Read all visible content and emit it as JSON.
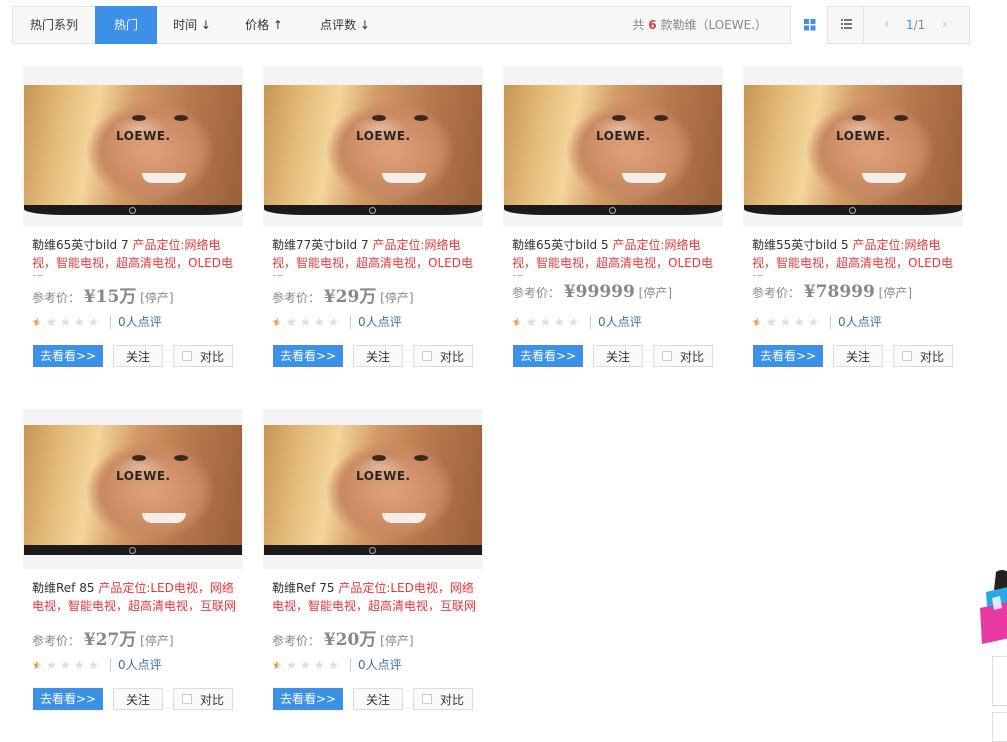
{
  "sort_bar": {
    "tabs": [
      {
        "label": "热门系列",
        "active": false
      },
      {
        "label": "热门",
        "active": true
      },
      {
        "label": "时间 ↓",
        "active": false
      },
      {
        "label": "价格 ↑",
        "active": false
      },
      {
        "label": "点评数 ↓",
        "active": false
      }
    ],
    "summary_prefix": "共",
    "summary_count": "6",
    "summary_suffix": "款勒维（LOEWE.）",
    "pager_prev": "‹",
    "pager_current": "1",
    "pager_sep_total": "/1",
    "pager_next": "›"
  },
  "labels": {
    "price_label": "参考价：",
    "discontinued": "[停产]",
    "go_button": "去看看>>",
    "follow_button": "关注",
    "compare_button": "对比"
  },
  "brand_logo_text": "LOEWE.",
  "products": [
    {
      "name": "勒维65英寸bild 7 ",
      "positioning": "产品定位:网络电视，智能电视，超高清电视，OLED电视，",
      "price": "¥15万",
      "reviews": "0人点评",
      "rating": 0.5
    },
    {
      "name": "勒维77英寸bild 7 ",
      "positioning": "产品定位:网络电视，智能电视，超高清电视，OLED电视，",
      "price": "¥29万",
      "reviews": "0人点评",
      "rating": 0.5
    },
    {
      "name": "勒维65英寸bild 5 ",
      "positioning": "产品定位:网络电视，智能电视，超高清电视，OLED电视，",
      "price": "¥99999",
      "reviews": "0人点评",
      "rating": 0.5
    },
    {
      "name": "勒维55英寸bild 5 ",
      "positioning": "产品定位:网络电视，智能电视，超高清电视，OLED电视，",
      "price": "¥78999",
      "reviews": "0人点评",
      "rating": 0.5
    },
    {
      "name": "勒维Ref 85 ",
      "positioning": "产品定位:LED电视，网络电视，智能电视，超高清电视，互联网",
      "price": "¥27万",
      "reviews": "0人点评",
      "rating": 0.5
    },
    {
      "name": "勒维Ref 75 ",
      "positioning": "产品定位:LED电视，网络电视，智能电视，超高清电视，互联网",
      "price": "¥20万",
      "reviews": "0人点评",
      "rating": 0.5
    }
  ],
  "colors": {
    "accent": "#3c91e6",
    "highlight": "#e4393c",
    "star": "#f08a1a"
  },
  "icons": [
    "grid-view-icon",
    "list-view-icon",
    "chevron-left-icon",
    "chevron-right-icon",
    "star-icon",
    "checkbox-icon"
  ]
}
